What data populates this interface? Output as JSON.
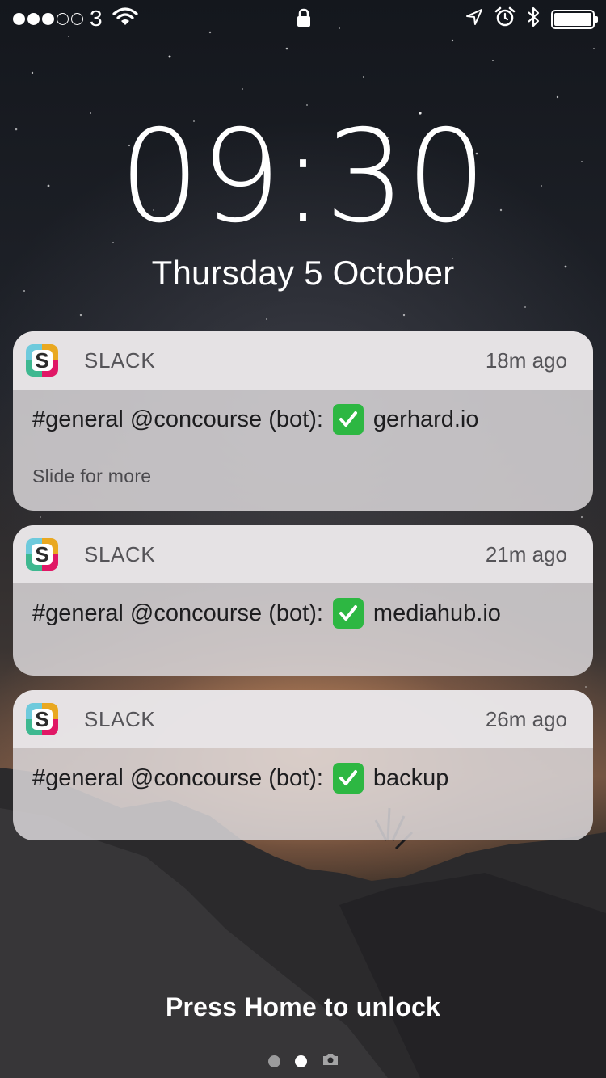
{
  "status_bar": {
    "signal_bars_filled": 3,
    "signal_bars_total": 5,
    "carrier": "3",
    "icons": [
      "wifi-icon",
      "lock-icon",
      "location-icon",
      "alarm-icon",
      "bluetooth-icon",
      "battery-icon"
    ],
    "battery_level": 1.0
  },
  "lock_screen": {
    "time": "09:30",
    "date": "Thursday 5 October"
  },
  "notifications": [
    {
      "app": "SLACK",
      "time_ago": "18m ago",
      "message_prefix": "#general @concourse (bot):",
      "message_suffix": "gerhard.io",
      "hint": "Slide for more"
    },
    {
      "app": "SLACK",
      "time_ago": "21m ago",
      "message_prefix": "#general @concourse (bot):",
      "message_suffix": "mediahub.io"
    },
    {
      "app": "SLACK",
      "time_ago": "26m ago",
      "message_prefix": "#general @concourse (bot):",
      "message_suffix": "backup"
    }
  ],
  "bottom": {
    "unlock_text": "Press Home to unlock",
    "page_count": 2,
    "active_page": 1
  },
  "colors": {
    "check_green": "#2db742",
    "card_background": "#dad6d8"
  }
}
